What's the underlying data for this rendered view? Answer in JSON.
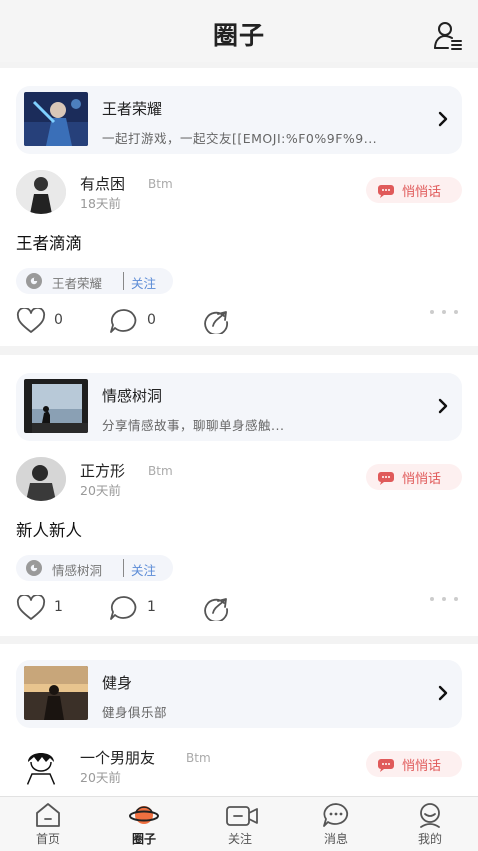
{
  "header": {
    "title": "圈子"
  },
  "posts": [
    {
      "circle": {
        "name": "王者荣耀",
        "desc": "一起打游戏，一起交友[[EMOJI:%F0%9F%9..."
      },
      "user": {
        "name": "有点困",
        "level": "Btm",
        "time": "18天前"
      },
      "whisper_label": "悄悄话",
      "content": "王者滴滴",
      "tag": {
        "name": "王者荣耀",
        "follow": "关注"
      },
      "likes": "0",
      "comments": "0"
    },
    {
      "circle": {
        "name": "情感树洞",
        "desc": "分享情感故事，聊聊单身感触..."
      },
      "user": {
        "name": "正方形",
        "level": "Btm",
        "time": "20天前"
      },
      "whisper_label": "悄悄话",
      "content": "新人新人",
      "tag": {
        "name": "情感树洞",
        "follow": "关注"
      },
      "likes": "1",
      "comments": "1"
    },
    {
      "circle": {
        "name": "健身",
        "desc": "健身俱乐部"
      },
      "user": {
        "name": "一个男朋友",
        "level": "Btm",
        "time": "20天前"
      },
      "whisper_label": "悄悄话"
    }
  ],
  "tabbar": [
    {
      "label": "首页",
      "icon": "home-icon"
    },
    {
      "label": "圈子",
      "icon": "planet-icon",
      "active": true
    },
    {
      "label": "关注",
      "icon": "video-camera-icon"
    },
    {
      "label": "消息",
      "icon": "message-icon"
    },
    {
      "label": "我的",
      "icon": "profile-icon"
    }
  ],
  "colors": {
    "whisper": "#e05a5a",
    "follow": "#5b8bd6",
    "active_tab": "#f07040"
  }
}
